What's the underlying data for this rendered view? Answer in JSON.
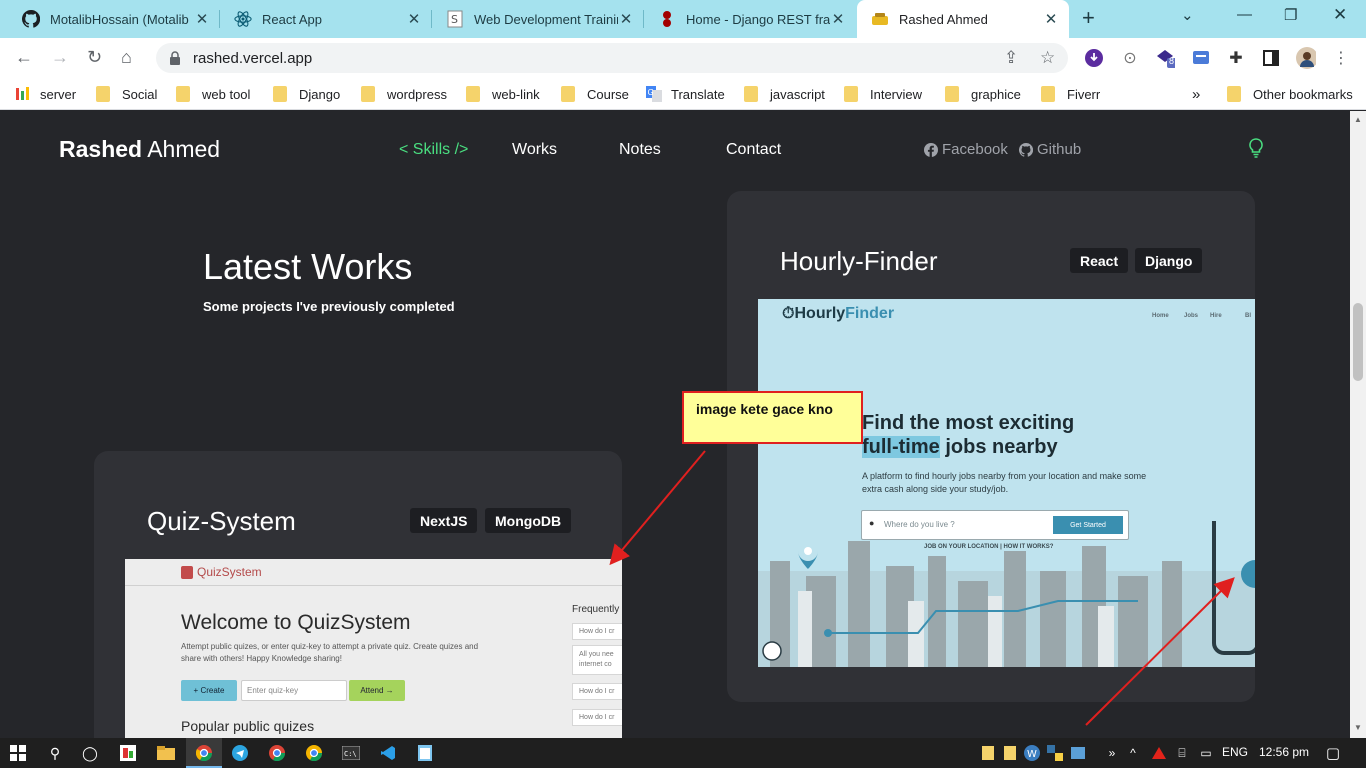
{
  "browser": {
    "tabs": [
      {
        "title": "MotalibHossain (Motalib",
        "icon": "github-icon"
      },
      {
        "title": "React App",
        "icon": "react-icon"
      },
      {
        "title": "Web Development Trainin",
        "icon": "web-dev-icon"
      },
      {
        "title": "Home - Django REST fram",
        "icon": "django-rest-icon"
      },
      {
        "title": "Rashed Ahmed",
        "icon": "page-icon",
        "active": true
      }
    ],
    "url": "rashed.vercel.app",
    "bookmarks": [
      "server",
      "Social",
      "web tool",
      "Django",
      "wordpress",
      "web-link",
      "Course",
      "Translate",
      "javascript",
      "Interview",
      "graphice",
      "Fiverr"
    ],
    "other_bookmarks": "Other bookmarks",
    "more_bookmarks": "»",
    "extension_badge": "8"
  },
  "site": {
    "brand_first": "Rashed",
    "brand_last": " Ahmed",
    "nav": [
      {
        "label": "< Skills />",
        "active": true
      },
      {
        "label": "Works"
      },
      {
        "label": "Notes"
      },
      {
        "label": "Contact"
      }
    ],
    "social": [
      {
        "label": "Facebook",
        "icon": "facebook-icon"
      },
      {
        "label": "Github",
        "icon": "github-icon"
      }
    ],
    "accent": "#4ade80"
  },
  "works": {
    "title": "Latest Works",
    "subtitle": "Some projects I've previously completed",
    "projects": [
      {
        "name": "Hourly-Finder",
        "tags": [
          "React",
          "Django"
        ],
        "preview": {
          "logo_a": "Hourly",
          "logo_b": "Finder",
          "nav": [
            "Home",
            "Jobs",
            "Hire",
            "Bl"
          ],
          "headline_1": "Find the most exciting",
          "headline_hl": "full-time",
          "headline_2": " jobs nearby",
          "text": "A platform to find hourly jobs nearby from your location and make some extra cash along side your study/job.",
          "search_placeholder": "Where do you live ?",
          "search_button": "Get Started",
          "links": "JOB ON YOUR LOCATION  |  HOW IT WORKS?"
        }
      },
      {
        "name": "Quiz-System",
        "tags": [
          "NextJS",
          "MongoDB"
        ],
        "preview": {
          "logo": "QuizSystem",
          "heading": "Welcome to QuizSystem",
          "text": "Attempt public quizes, or enter quiz-key to attempt a private quiz. Create quizes and share with others! Happy Knowledge sharing!",
          "create": "+ Create",
          "key_placeholder": "Enter quiz-key",
          "attend": "Attend →",
          "popular": "Popular public quizes",
          "faq_title": "Frequently",
          "faq": [
            "How do I cr",
            "All you nee internet co",
            "How do I cr",
            "How do I cr"
          ]
        }
      }
    ]
  },
  "annotation": {
    "text": "image kete gace kno"
  },
  "taskbar": {
    "lang": "ENG",
    "time": "12:56 pm"
  }
}
